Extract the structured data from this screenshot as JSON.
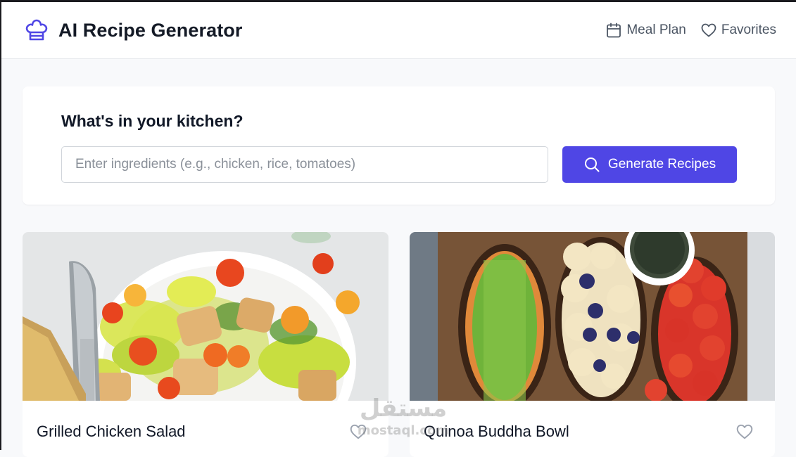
{
  "header": {
    "title": "AI Recipe Generator",
    "logo_icon": "chef-hat-icon",
    "nav": [
      {
        "label": "Meal Plan",
        "icon": "calendar-icon"
      },
      {
        "label": "Favorites",
        "icon": "heart-icon"
      }
    ]
  },
  "search": {
    "heading": "What's in your kitchen?",
    "input_value": "",
    "placeholder": "Enter ingredients (e.g., chicken, rice, tomatoes)",
    "button_label": "Generate Recipes",
    "button_icon": "search-icon"
  },
  "recipes": [
    {
      "name": "Grilled Chicken Salad",
      "favorite_icon": "heart-outline-icon"
    },
    {
      "name": "Quinoa Buddha Bowl",
      "favorite_icon": "heart-outline-icon"
    }
  ],
  "watermark": {
    "arabic": "مستقل",
    "latin": "mostaql.com"
  },
  "colors": {
    "accent": "#4f46e5",
    "page_background": "#f8f9fb",
    "card_background": "#ffffff",
    "heading_text": "#111827",
    "muted_text": "#4b5563"
  }
}
